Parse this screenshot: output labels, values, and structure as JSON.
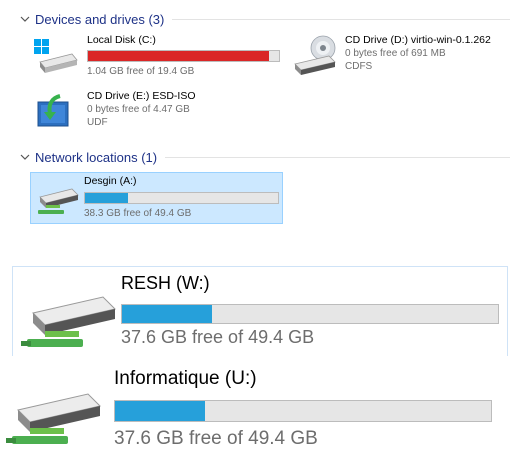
{
  "groups": {
    "devices": {
      "label": "Devices and drives (3)"
    },
    "network": {
      "label": "Network locations (1)"
    }
  },
  "drives": {
    "local_c": {
      "name": "Local Disk (C:)",
      "free_text": "1.04 GB free of 19.4 GB",
      "used_fraction": 0.946,
      "bar_color": "#da2626",
      "icon": "windows-drive-icon"
    },
    "cd_d": {
      "name": "CD Drive (D:) virtio-win-0.1.262",
      "free_text": "0 bytes free of 691 MB",
      "filesystem": "CDFS",
      "icon": "cd-drive-icon"
    },
    "cd_e": {
      "name": "CD Drive (E:) ESD-ISO",
      "free_text": "0 bytes free of 4.47 GB",
      "filesystem": "UDF",
      "icon": "cd-install-icon"
    },
    "desgin_a": {
      "name": "Desgin (A:)",
      "free_text": "38.3 GB free of 49.4 GB",
      "used_fraction": 0.225,
      "bar_color": "#26a0da",
      "icon": "network-drive-icon"
    }
  },
  "big_drives": {
    "resh_w": {
      "name": "RESH (W:)",
      "free_text": "37.6 GB free of 49.4 GB",
      "used_fraction": 0.239,
      "bar_color": "#26a0da",
      "icon": "network-drive-icon"
    },
    "info_u": {
      "name": "Informatique (U:)",
      "free_text": "37.6 GB free of 49.4 GB",
      "used_fraction": 0.239,
      "bar_color": "#26a0da",
      "icon": "network-drive-icon"
    }
  },
  "colors": {
    "selection_bg": "#cce8ff",
    "selection_border": "#99d1ff",
    "group_text": "#1e3287"
  }
}
